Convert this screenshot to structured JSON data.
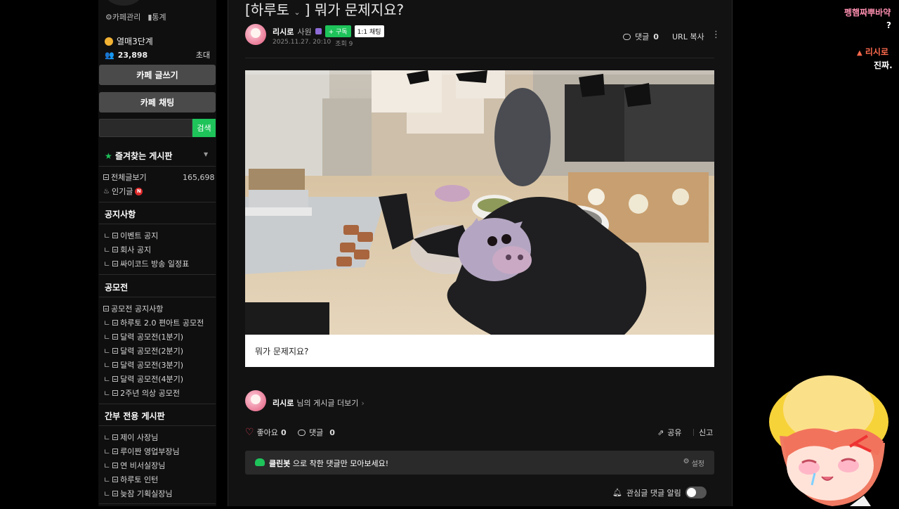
{
  "sidebar": {
    "top_links": [
      "카페관리",
      "통계"
    ],
    "level": "열매3단계",
    "members": "23,898",
    "invite": "초대",
    "write_button": "카페 글쓰기",
    "chat_button": "카페 채팅",
    "search_button": "검색",
    "favorites_title": "즐겨찾는 게시판",
    "all_posts": {
      "label": "전체글보기",
      "count": "165,698"
    },
    "popular": "인기글",
    "new_badge": "N",
    "sections": [
      {
        "title": "공지사항",
        "items": [
          "이벤트 공지",
          "회사 공지",
          "싸이코드 방송 일정표"
        ]
      },
      {
        "title": "공모전",
        "items": [
          "공모전 공지사항",
          "하루토 2.0 편아트 공모전",
          "달력 공모전(1분기)",
          "달력 공모전(2분기)",
          "달력 공모전(3분기)",
          "달력 공모전(4분기)",
          "2주년 의상 공모전"
        ]
      },
      {
        "title": "간부 전용 게시판",
        "items": [
          "제이 사장님",
          "루이짠 영업부장님",
          "연 비서실장님",
          "하루토 인턴",
          "늦잠 기획실장님"
        ]
      }
    ]
  },
  "post": {
    "category": "[하루토",
    "title_rest": "] 뭐가 문제지요?",
    "author": "리시로",
    "role": "사원",
    "subscribe": "+ 구독",
    "chat": "1:1 채팅",
    "date": "2025.11.27. 20:10",
    "views": "조회 9",
    "comments_label": "댓글",
    "comments_count": "0",
    "url_copy": "URL 복사",
    "caption": "뭐가 문제지요?",
    "more_posts_name": "리시로",
    "more_posts_suffix": "님의 게시글 더보기",
    "like_label": "좋아요",
    "like_count": "0",
    "comment_label": "댓글",
    "comment_count": "0",
    "share": "공유",
    "report": "신고",
    "cleanbot_name": "클린봇",
    "cleanbot_text": " 으로 착한 댓글만 모아보세요!",
    "settings": "설정",
    "notify": "관심글 댓글 알림"
  },
  "chat": {
    "line1": "펭햄짜뿌바약",
    "line2": "?",
    "line3_name": "리시로",
    "line4": "진짜."
  },
  "colors": {
    "accent_green": "#1ec35a",
    "like_red": "#e0404f",
    "chat_pink": "#ff8fb0",
    "chat_orange": "#ff6a4d"
  }
}
